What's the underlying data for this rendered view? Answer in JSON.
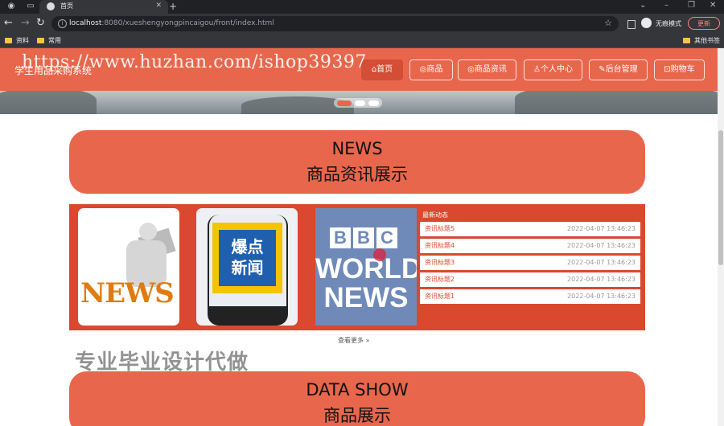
{
  "browser": {
    "tab_title": "首页",
    "url_host": "localhost",
    "url_rest": ":8080/xueshengyongpincaigou/front/index.html",
    "incognito_label": "无痕模式",
    "update_label": "更新",
    "bookmarks": [
      "资料",
      "常用"
    ],
    "other_bookmarks": "其他书签"
  },
  "site": {
    "name": "学生用品采购系统",
    "watermark": "https://www.huzhan.com/ishop39397",
    "nav": [
      {
        "label": "首页"
      },
      {
        "label": "商品"
      },
      {
        "label": "商品资讯"
      },
      {
        "label": "个人中心"
      },
      {
        "label": "后台管理"
      },
      {
        "label": "购物车"
      }
    ]
  },
  "news_section": {
    "title_en": "NEWS",
    "title_zh": "商品资讯展示",
    "images": [
      {
        "text": "NEWS"
      },
      {
        "text_line1": "爆点",
        "text_line2": "新闻"
      },
      {
        "text_bbc": [
          "B",
          "B",
          "C"
        ],
        "text_line1": "WORLD",
        "text_line2": "NEWS"
      }
    ],
    "latest_title": "最新动态",
    "items": [
      {
        "title": "资讯标题5",
        "date": "2022-04-07 13:46:23"
      },
      {
        "title": "资讯标题4",
        "date": "2022-04-07 13:46:23"
      },
      {
        "title": "资讯标题3",
        "date": "2022-04-07 13:46:23"
      },
      {
        "title": "资讯标题2",
        "date": "2022-04-07 13:46:23"
      },
      {
        "title": "资讯标题1",
        "date": "2022-04-07 13:46:23"
      }
    ],
    "more_label": "查看更多 »"
  },
  "promo_text": "专业毕业设计代做",
  "data_section": {
    "title_en": "DATA SHOW",
    "title_zh": "商品展示"
  },
  "colors": {
    "accent": "#e8664c",
    "panel": "#d9482f"
  }
}
